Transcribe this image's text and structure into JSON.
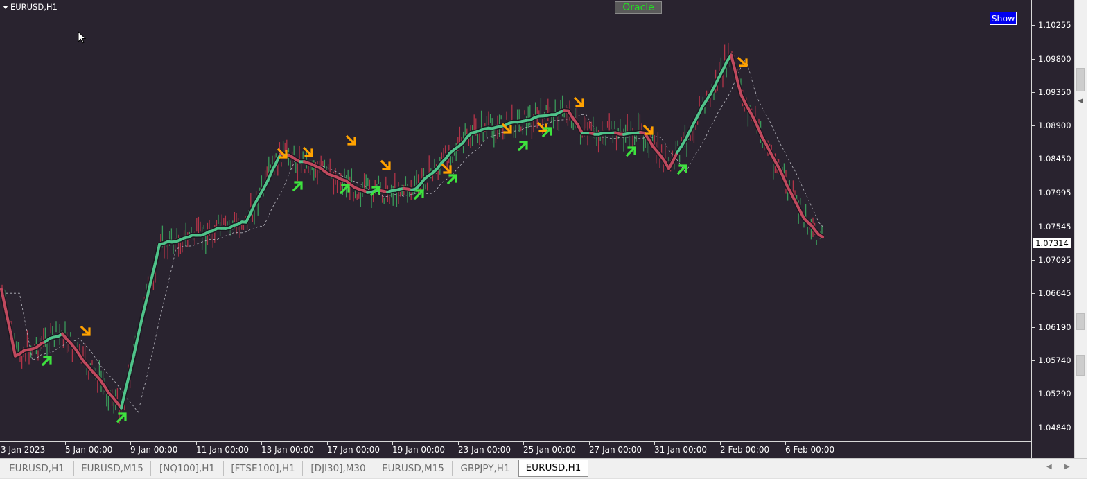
{
  "window": {
    "symbol_title": "EURUSD,H1"
  },
  "buttons": {
    "oracle_label": "Oracle",
    "show_label": "Show"
  },
  "colors": {
    "background": "#29232f",
    "bull_candle": "#3a9a5a",
    "bear_candle": "#b23448",
    "trend_up": "#4fc38a",
    "trend_down": "#c0495e",
    "signal_buy": "#3ee23e",
    "signal_sell": "#ffa200",
    "oracle_text": "#22dd22",
    "show_bg": "#0000ee"
  },
  "price_axis": {
    "labels": [
      "1.10255",
      "1.09800",
      "1.09350",
      "1.08900",
      "1.08450",
      "1.07995",
      "1.07545",
      "1.07095",
      "1.06645",
      "1.06190",
      "1.05740",
      "1.05290",
      "1.04840"
    ],
    "current_price": "1.07314"
  },
  "time_axis": {
    "labels": [
      "3 Jan 2023",
      "5 Jan 00:00",
      "9 Jan 00:00",
      "11 Jan 00:00",
      "13 Jan 00:00",
      "17 Jan 00:00",
      "19 Jan 00:00",
      "23 Jan 00:00",
      "25 Jan 00:00",
      "27 Jan 00:00",
      "31 Jan 00:00",
      "2 Feb 00:00",
      "6 Feb 00:00"
    ]
  },
  "tabs": [
    {
      "label": "EURUSD,H1",
      "active": false
    },
    {
      "label": "EURUSD,M15",
      "active": false
    },
    {
      "label": "[NQ100],H1",
      "active": false
    },
    {
      "label": "[FTSE100],H1",
      "active": false
    },
    {
      "label": "[DJI30],M30",
      "active": false
    },
    {
      "label": "EURUSD,M15",
      "active": false
    },
    {
      "label": "GBPJPY,H1",
      "active": false
    },
    {
      "label": "EURUSD,H1",
      "active": true
    }
  ],
  "chart_data": {
    "type": "line",
    "ylim": [
      1.0465,
      1.1059
    ],
    "trend_line": [
      {
        "x": "3 Jan 2023",
        "y": 1.067
      },
      {
        "x": "4 Jan",
        "y": 1.058
      },
      {
        "x": "5 Jan",
        "y": 1.061
      },
      {
        "x": "6 Jan",
        "y": 1.051
      },
      {
        "x": "9 Jan",
        "y": 1.073
      },
      {
        "x": "12 Jan",
        "y": 1.076
      },
      {
        "x": "13 Jan",
        "y": 1.0852
      },
      {
        "x": "16 Jan",
        "y": 1.0838
      },
      {
        "x": "18 Jan",
        "y": 1.08
      },
      {
        "x": "20 Jan",
        "y": 1.0805
      },
      {
        "x": "23 Jan",
        "y": 1.088
      },
      {
        "x": "25 Jan",
        "y": 1.091
      },
      {
        "x": "26 Jan",
        "y": 1.088
      },
      {
        "x": "30 Jan",
        "y": 1.088
      },
      {
        "x": "31 Jan",
        "y": 1.0832
      },
      {
        "x": "2 Feb",
        "y": 1.0985
      },
      {
        "x": "3 Feb",
        "y": 1.093
      },
      {
        "x": "6 Feb",
        "y": 1.0765
      },
      {
        "x": "7 Feb",
        "y": 1.074
      }
    ]
  }
}
